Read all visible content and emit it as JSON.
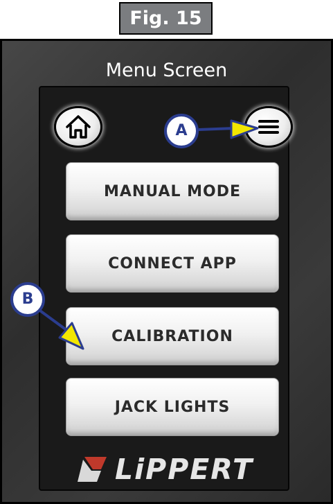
{
  "figure_label": "Fig. 15",
  "screen_title": "Menu Screen",
  "buttons": {
    "home_icon": "home-icon",
    "menu_icon": "hamburger-menu-icon"
  },
  "menu_items": [
    {
      "label": "MANUAL MODE"
    },
    {
      "label": "CONNECT APP"
    },
    {
      "label": "CALIBRATION"
    },
    {
      "label": "JACK LIGHTS"
    }
  ],
  "brand": {
    "name": "LiPPERT",
    "logo_color": "#c0392b"
  },
  "callouts": [
    {
      "letter": "A",
      "target": "hamburger-menu-icon"
    },
    {
      "letter": "B",
      "target": "CALIBRATION"
    }
  ],
  "colors": {
    "callout_blue": "#2b3d8f",
    "arrow_yellow": "#f2e600",
    "figure_tag_gray": "#7b7d80"
  }
}
